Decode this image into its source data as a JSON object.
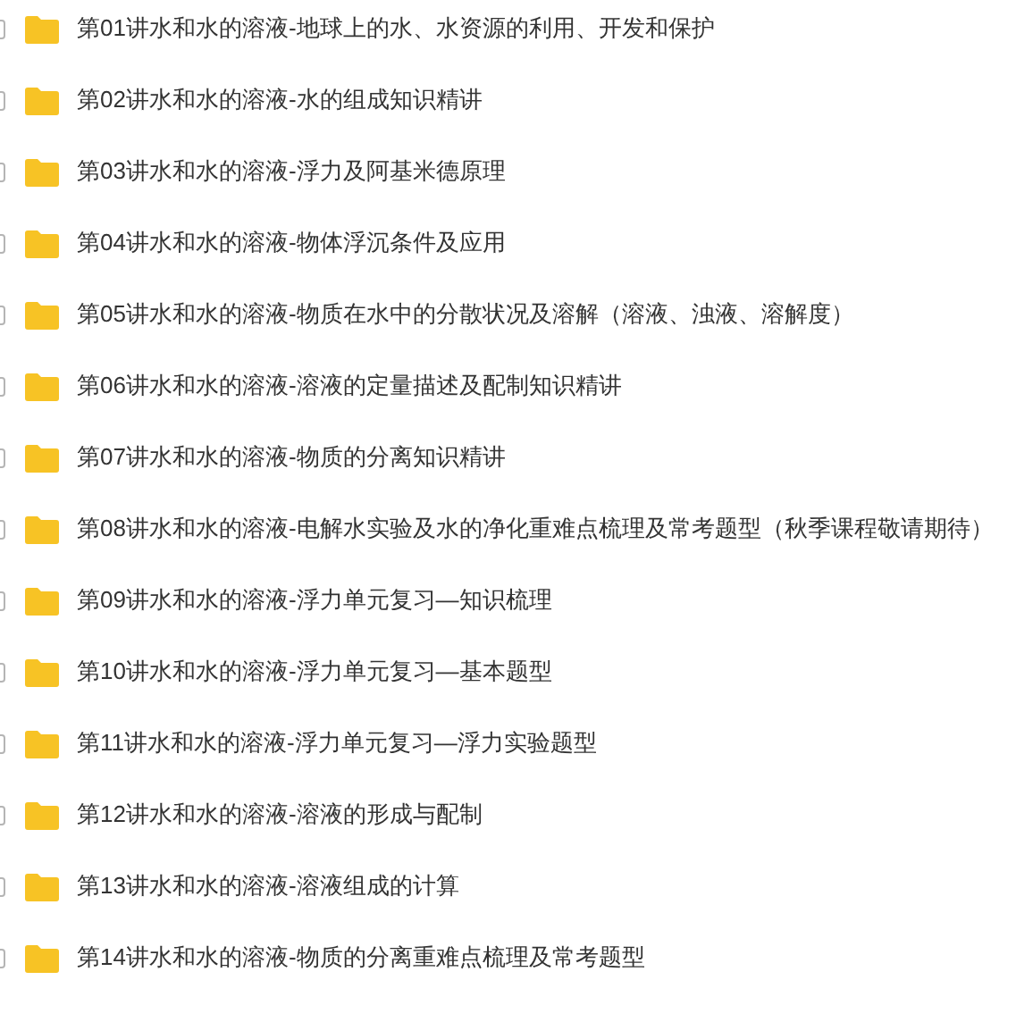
{
  "items": [
    {
      "name": "第01讲水和水的溶液-地球上的水、水资源的利用、开发和保护",
      "checked": false
    },
    {
      "name": "第02讲水和水的溶液-水的组成知识精讲",
      "checked": false
    },
    {
      "name": "第03讲水和水的溶液-浮力及阿基米德原理",
      "checked": false
    },
    {
      "name": "第04讲水和水的溶液-物体浮沉条件及应用",
      "checked": false
    },
    {
      "name": "第05讲水和水的溶液-物质在水中的分散状况及溶解（溶液、浊液、溶解度）",
      "checked": false
    },
    {
      "name": "第06讲水和水的溶液-溶液的定量描述及配制知识精讲",
      "checked": false
    },
    {
      "name": "第07讲水和水的溶液-物质的分离知识精讲",
      "checked": false
    },
    {
      "name": "第08讲水和水的溶液-电解水实验及水的净化重难点梳理及常考题型（秋季课程敬请期待）",
      "checked": false
    },
    {
      "name": "第09讲水和水的溶液-浮力单元复习—知识梳理",
      "checked": false
    },
    {
      "name": "第10讲水和水的溶液-浮力单元复习—基本题型",
      "checked": false
    },
    {
      "name": "第11讲水和水的溶液-浮力单元复习—浮力实验题型",
      "checked": false
    },
    {
      "name": "第12讲水和水的溶液-溶液的形成与配制",
      "checked": false
    },
    {
      "name": "第13讲水和水的溶液-溶液组成的计算",
      "checked": false
    },
    {
      "name": "第14讲水和水的溶液-物质的分离重难点梳理及常考题型",
      "checked": false
    }
  ]
}
